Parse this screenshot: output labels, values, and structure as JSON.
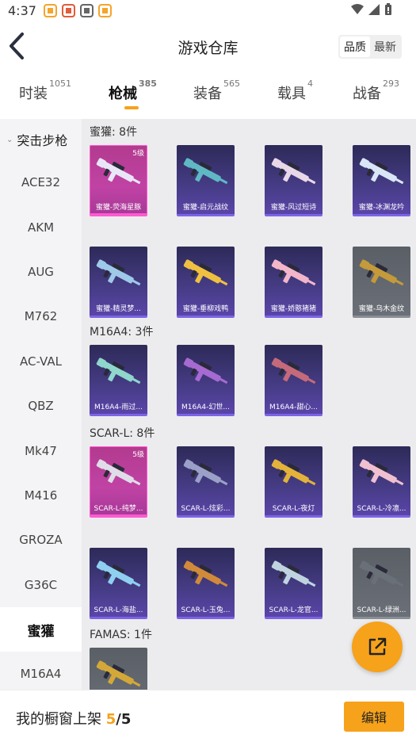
{
  "status": {
    "time": "4:37",
    "apps": [
      {
        "icon": "pubg-coin-icon",
        "color": "#f4a52c"
      },
      {
        "icon": "game-mascot-icon",
        "color": "#e25b3a"
      },
      {
        "icon": "mail-icon",
        "color": "#666666"
      },
      {
        "icon": "pubg-coin-icon",
        "color": "#f4a52c"
      }
    ]
  },
  "header": {
    "title": "游戏仓库",
    "sort_quality": "品质",
    "sort_latest": "最新"
  },
  "tabs": [
    {
      "label": "时装",
      "count": "1051"
    },
    {
      "label": "枪械",
      "count": "385"
    },
    {
      "label": "装备",
      "count": "565"
    },
    {
      "label": "载具",
      "count": "4"
    },
    {
      "label": "战备",
      "count": "293"
    }
  ],
  "sidebar": {
    "category": "突击步枪",
    "items": [
      "ACE32",
      "AKM",
      "AUG",
      "M762",
      "AC-VAL",
      "QBZ",
      "Mk47",
      "M416",
      "GROZA",
      "G36C",
      "蜜獾",
      "M16A4"
    ]
  },
  "sections": [
    {
      "title": "蜜獾: 8件",
      "items": [
        {
          "name": "蜜獾-荧海星豚",
          "level": "5级",
          "rarity": "gold",
          "gun_color": "#e9e6f7"
        },
        {
          "name": "蜜獾-启元战纹",
          "level": "",
          "rarity": "purple",
          "gun_color": "#5fb8c4"
        },
        {
          "name": "蜜獾-风过短诗",
          "level": "",
          "rarity": "purple",
          "gun_color": "#e8d8e8"
        },
        {
          "name": "蜜獾-冰渊龙吟",
          "level": "",
          "rarity": "purple",
          "gun_color": "#d9e6f5"
        },
        {
          "name": "蜜獾-精灵梦...",
          "level": "",
          "rarity": "purple",
          "gun_color": "#9ec9e8"
        },
        {
          "name": "蜜獾-垂柳戏鸭",
          "level": "",
          "rarity": "purple",
          "gun_color": "#f0c040"
        },
        {
          "name": "蜜獾-娇憨猪猪",
          "level": "",
          "rarity": "purple",
          "gun_color": "#f3b5c9"
        },
        {
          "name": "蜜獾-乌木金纹",
          "level": "",
          "rarity": "grey",
          "gun_color": "#c49a3a"
        }
      ]
    },
    {
      "title": "M16A4: 3件",
      "items": [
        {
          "name": "M16A4-雨过...",
          "level": "",
          "rarity": "purple",
          "gun_color": "#8fd6cc"
        },
        {
          "name": "M16A4-幻世...",
          "level": "",
          "rarity": "purple",
          "gun_color": "#a66ad0"
        },
        {
          "name": "M16A4-甜心...",
          "level": "",
          "rarity": "purple",
          "gun_color": "#c46a7a"
        }
      ]
    },
    {
      "title": "SCAR-L: 8件",
      "items": [
        {
          "name": "SCAR-L-纯梦...",
          "level": "5级",
          "rarity": "gold",
          "gun_color": "#e0dde8"
        },
        {
          "name": "SCAR-L-炫彩...",
          "level": "",
          "rarity": "purple",
          "gun_color": "#9aa0c8"
        },
        {
          "name": "SCAR-L-夜灯",
          "level": "",
          "rarity": "purple",
          "gun_color": "#e2b23a"
        },
        {
          "name": "SCAR-L-冷凛...",
          "level": "",
          "rarity": "purple",
          "gun_color": "#f0c0d0"
        },
        {
          "name": "SCAR-L-海盐...",
          "level": "",
          "rarity": "purple",
          "gun_color": "#8fd0f0"
        },
        {
          "name": "SCAR-L-玉兔...",
          "level": "",
          "rarity": "purple",
          "gun_color": "#d08a3a"
        },
        {
          "name": "SCAR-L-龙官...",
          "level": "",
          "rarity": "purple",
          "gun_color": "#c0d4e0"
        },
        {
          "name": "SCAR-L-绿洲...",
          "level": "",
          "rarity": "grey",
          "gun_color": "#6a7078"
        }
      ]
    },
    {
      "title": "FAMAS: 1件",
      "items": [
        {
          "name": "",
          "level": "",
          "rarity": "grey",
          "gun_color": "#d4a838"
        }
      ]
    }
  ],
  "bottom": {
    "shelf_label": "我的橱窗上架",
    "shelf_count": "5",
    "shelf_sep": "/",
    "shelf_total": "5",
    "edit_label": "编辑"
  },
  "colors": {
    "accent": "#f6a21a"
  }
}
